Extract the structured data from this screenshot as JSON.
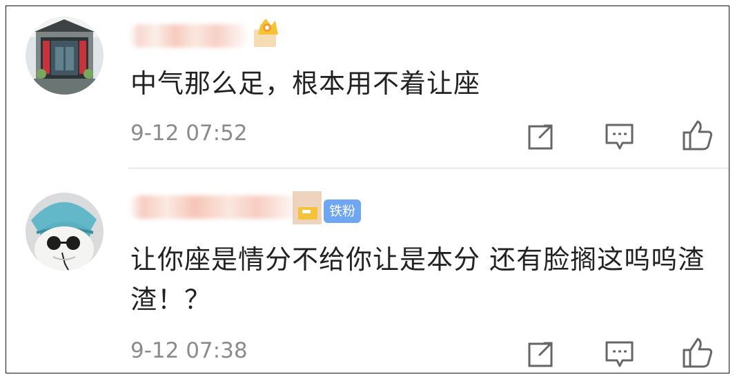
{
  "comments": [
    {
      "text": "中气那么足，根本用不着让座",
      "time": "9-12 07:52",
      "avatar_icon": "temple-gate-avatar",
      "vip_icon": "crown-icon"
    },
    {
      "text": "让你座是情分不给你让是本分 还有脸搁这呜呜渣渣！？",
      "time": "9-12 07:38",
      "avatar_icon": "cat-with-hat-avatar",
      "badge": "铁粉",
      "vip_icon": "gold-level-icon"
    }
  ],
  "colors": {
    "text": "#222222",
    "time": "#8b8b8b",
    "badge": "#6fa6f2",
    "icon": "#666666"
  }
}
